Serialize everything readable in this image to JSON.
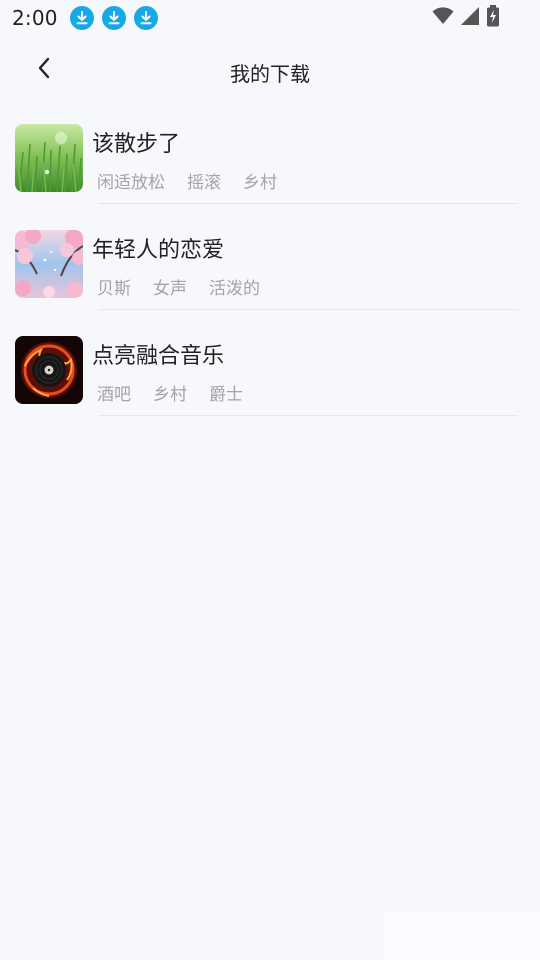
{
  "status_bar": {
    "time": "2:00",
    "notifications": [
      "download-icon",
      "download-icon",
      "download-icon"
    ],
    "accent": "#17a8e8"
  },
  "header": {
    "back_icon": "chevron-left-icon",
    "title": "我的下载"
  },
  "downloads": [
    {
      "title": "该散步了",
      "cover": "grass-field-cover",
      "tags": [
        "闲适放松",
        "摇滚",
        "乡村"
      ]
    },
    {
      "title": "年轻人的恋爱",
      "cover": "cherry-blossom-cover",
      "tags": [
        "贝斯",
        "女声",
        "活泼的"
      ]
    },
    {
      "title": "点亮融合音乐",
      "cover": "fire-vinyl-cover",
      "tags": [
        "酒吧",
        "乡村",
        "爵士"
      ]
    }
  ]
}
